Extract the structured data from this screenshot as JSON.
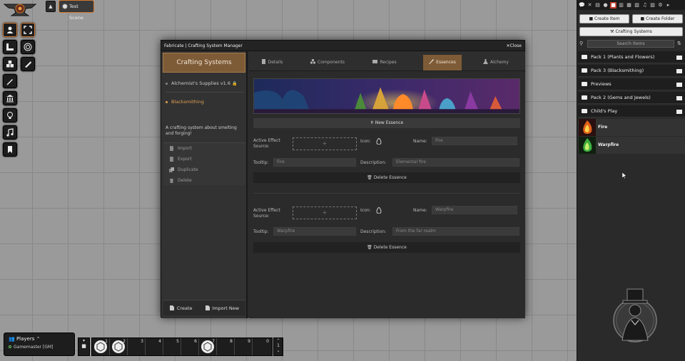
{
  "scene": {
    "label": "Test Scene"
  },
  "window": {
    "title": "Fabricate | Crafting System Manager",
    "close_label": "Close"
  },
  "sidebar": {
    "title": "Crafting Systems",
    "systems": [
      {
        "label": "Alchemist's Supplies v1.6",
        "locked": true,
        "selected": false
      },
      {
        "label": "Blacksmithing",
        "locked": false,
        "selected": true
      }
    ],
    "description": "A crafting system about smelting and forging!",
    "actions": [
      {
        "label": "Import",
        "icon": "import-icon"
      },
      {
        "label": "Export",
        "icon": "export-icon"
      },
      {
        "label": "Duplicate",
        "icon": "duplicate-icon"
      },
      {
        "label": "Delete",
        "icon": "trash-icon"
      }
    ],
    "footer": {
      "create_label": "Create",
      "import_label": "Import New"
    }
  },
  "tabs": [
    {
      "label": "Details",
      "icon": "book-icon",
      "active": false
    },
    {
      "label": "Components",
      "icon": "cubes-icon",
      "active": false
    },
    {
      "label": "Recipes",
      "icon": "scroll-icon",
      "active": false
    },
    {
      "label": "Essences",
      "icon": "mortar-icon",
      "active": true
    },
    {
      "label": "Alchemy",
      "icon": "flask-icon",
      "active": false
    }
  ],
  "essences_panel": {
    "new_essence_label": "New Essence",
    "labels": {
      "active_effect_source": "Active Effect Source:",
      "icon": "Icon:",
      "name": "Name:",
      "tooltip": "Tooltip:",
      "description": "Description:",
      "delete": "Delete Essence",
      "dropzone": "+"
    },
    "essences": [
      {
        "name": "Fire",
        "tooltip": "Fire",
        "description": "Elemental fire",
        "icon": "fire-icon"
      },
      {
        "name": "Warpfire",
        "tooltip": "Warpfire",
        "description": "From the far realm",
        "icon": "fire-icon"
      }
    ]
  },
  "right_panel": {
    "tabs": [
      "chat-icon",
      "combat-icon",
      "scenes-icon",
      "actors-icon",
      "items-icon",
      "journal-icon",
      "tables-icon",
      "cards-icon",
      "playlists-icon",
      "compendium-icon",
      "settings-icon",
      "collapse-icon"
    ],
    "active_tab": 4,
    "create_item_label": "Create Item",
    "create_folder_label": "Create Folder",
    "crafting_systems_label": "Crafting Systems",
    "search_placeholder": "Search Items",
    "folders": [
      {
        "label": "Pack 1 (Plants and Flowers)"
      },
      {
        "label": "Pack 3 (Blacksmithing)"
      },
      {
        "label": "Previews"
      },
      {
        "label": "Pack 2 (Gems and Jewels)"
      },
      {
        "label": "Child's Play"
      }
    ],
    "items": [
      {
        "label": "Fire",
        "color": "#e0611a"
      },
      {
        "label": "Warpfire",
        "color": "#3fae3f"
      }
    ]
  },
  "players": {
    "title": "Players",
    "users": [
      {
        "label": "Gamemaster [GM]"
      }
    ]
  },
  "hotbar": {
    "slots": [
      "1",
      "2",
      "3",
      "4",
      "5",
      "6",
      "7",
      "8",
      "9",
      "0"
    ],
    "filled": [
      true,
      true,
      false,
      false,
      false,
      false,
      true,
      false,
      false,
      false
    ],
    "page": "1"
  },
  "colors": {
    "accent": "#7e5b37",
    "highlight": "#e09f52",
    "scene_border": "#d27a32"
  }
}
